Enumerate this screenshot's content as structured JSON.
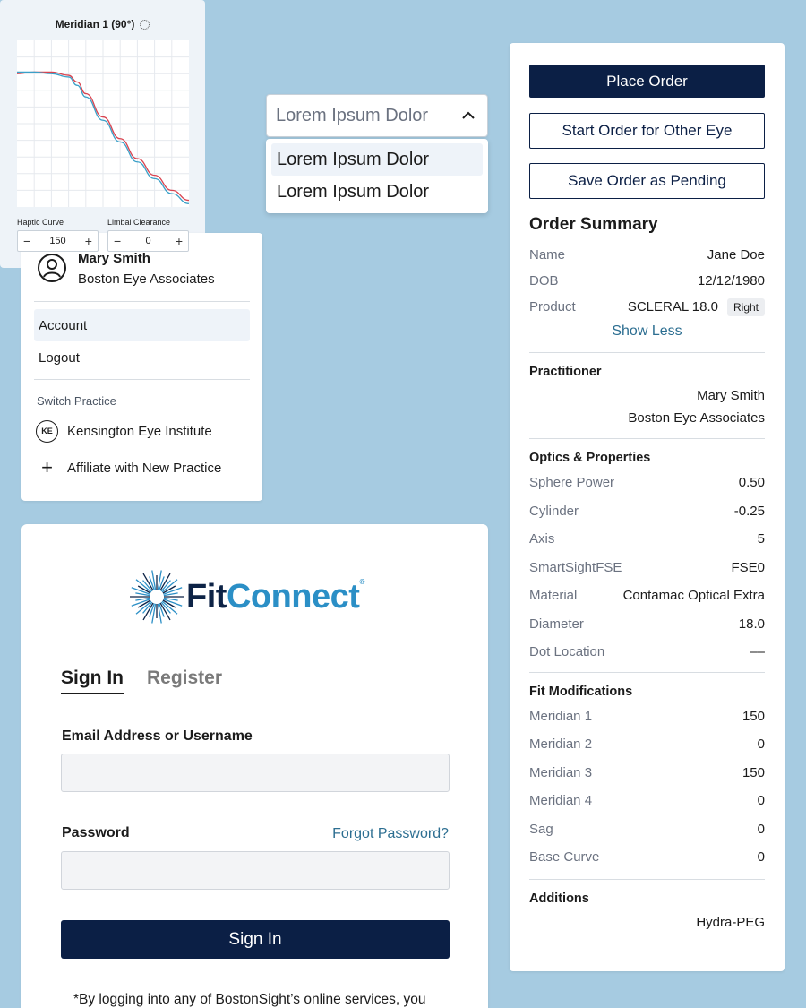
{
  "dropdown": {
    "selected": "Lorem Ipsum Dolor",
    "options": [
      "Lorem Ipsum Dolor",
      "Lorem Ipsum Dolor"
    ]
  },
  "account_menu": {
    "user_name": "Mary Smith",
    "practice": "Boston Eye Associates",
    "account_label": "Account",
    "logout_label": "Logout",
    "switch_label": "Switch Practice",
    "other_practice_initials": "KE",
    "other_practice": "Kensington Eye Institute",
    "affiliate_label": "Affiliate with New Practice"
  },
  "chart_widget": {
    "title": "Meridian 1 (90°)",
    "haptic_label": "Haptic Curve",
    "haptic_value": "150",
    "limbal_label": "Limbal Clearance",
    "limbal_value": "0",
    "minus": "−",
    "plus": "+"
  },
  "chart_data": {
    "type": "line",
    "title": "Meridian 1 (90°)",
    "xlim": [
      0,
      10
    ],
    "ylim": [
      0,
      10
    ],
    "grid": true,
    "series": [
      {
        "color": "#d9434f",
        "x": [
          0,
          1,
          2,
          3,
          3.5,
          4,
          5,
          6,
          7,
          8,
          9,
          10
        ],
        "y": [
          8,
          8.1,
          8.1,
          7.9,
          7.5,
          6.8,
          5.4,
          4.1,
          2.9,
          1.9,
          1.0,
          0.4
        ]
      },
      {
        "color": "#3aa0c8",
        "x": [
          0,
          1,
          2,
          3,
          3.5,
          4,
          5,
          6,
          7,
          8,
          9,
          10
        ],
        "y": [
          8.1,
          8.1,
          8.0,
          7.8,
          7.3,
          6.6,
          5.2,
          3.9,
          2.7,
          1.7,
          0.8,
          0.2
        ]
      }
    ]
  },
  "login": {
    "logo_fit": "Fit",
    "logo_connect": "Connect",
    "logo_mark": "®",
    "tab_signin": "Sign In",
    "tab_register": "Register",
    "email_label": "Email Address or Username",
    "password_label": "Password",
    "forgot_label": "Forgot Password?",
    "signin_button": "Sign In",
    "disclaimer": "*By logging into any of BostonSight’s online services, you"
  },
  "order": {
    "place_order": "Place Order",
    "start_other_eye": "Start Order for Other Eye",
    "save_pending": "Save Order as Pending",
    "summary_title": "Order Summary",
    "summary_rows": [
      {
        "k": "Name",
        "v": "Jane Doe"
      },
      {
        "k": "DOB",
        "v": "12/12/1980"
      },
      {
        "k": "Product",
        "v": "SCLERAL 18.0",
        "badge": "Right"
      }
    ],
    "show_less": "Show Less",
    "practitioner_title": "Practitioner",
    "practitioner_name": "Mary Smith",
    "practitioner_practice": "Boston Eye Associates",
    "optics_title": "Optics & Properties",
    "optics_rows": [
      {
        "k": "Sphere Power",
        "v": "0.50"
      },
      {
        "k": "Cylinder",
        "v": "-0.25"
      },
      {
        "k": "Axis",
        "v": "5"
      },
      {
        "k": "SmartSightFSE",
        "v": "FSE0"
      },
      {
        "k": "Material",
        "v": "Contamac Optical Extra"
      },
      {
        "k": "Diameter",
        "v": "18.0"
      },
      {
        "k": "Dot Location",
        "v": "––"
      }
    ],
    "fit_title": "Fit Modifications",
    "fit_rows": [
      {
        "k": "Meridian 1",
        "v": "150"
      },
      {
        "k": "Meridian 2",
        "v": "0"
      },
      {
        "k": "Meridian 3",
        "v": "150"
      },
      {
        "k": "Meridian 4",
        "v": "0"
      },
      {
        "k": "Sag",
        "v": "0"
      },
      {
        "k": "Base Curve",
        "v": "0"
      }
    ],
    "additions_title": "Additions",
    "additions_value": "Hydra-PEG"
  }
}
